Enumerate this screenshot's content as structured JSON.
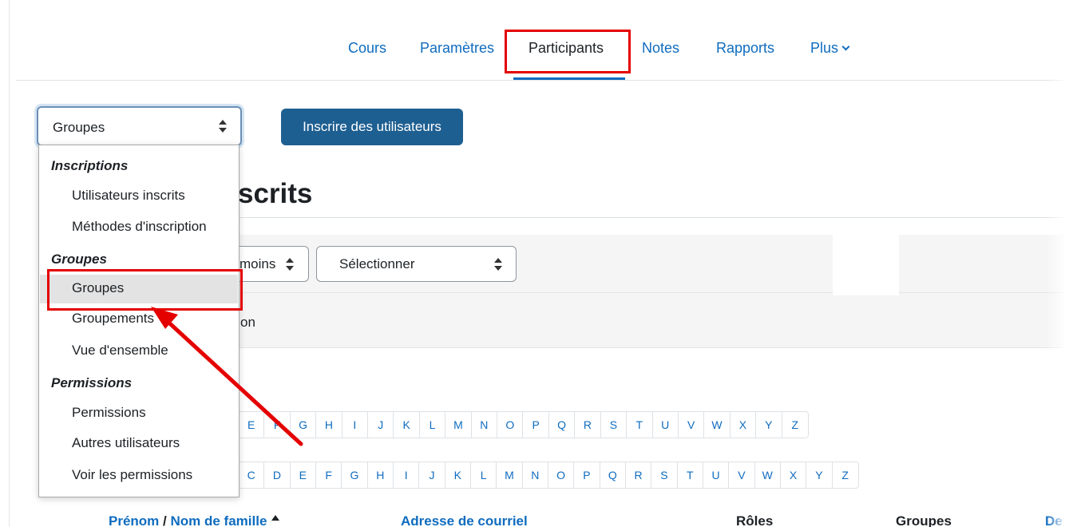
{
  "nav": {
    "items": [
      "Cours",
      "Paramètres",
      "Participants",
      "Notes",
      "Rapports",
      "Plus"
    ],
    "active": "Participants"
  },
  "main_select": {
    "value": "Groupes"
  },
  "enrol_button": {
    "label": "Inscrire des utilisateurs"
  },
  "heading": {
    "text": "scrits"
  },
  "filters": {
    "match_select": "moins",
    "type_select": "Sélectionner",
    "band_text": "on"
  },
  "dropdown": {
    "groups": [
      {
        "label": "Inscriptions",
        "options": [
          "Utilisateurs inscrits",
          "Méthodes d'inscription"
        ]
      },
      {
        "label": "Groupes",
        "options": [
          "Groupes",
          "Groupements",
          "Vue d'ensemble"
        ]
      },
      {
        "label": "Permissions",
        "options": [
          "Permissions",
          "Autres utilisateurs",
          "Voir les permissions"
        ]
      }
    ],
    "selected": "Groupes"
  },
  "initials_firstname": [
    "E",
    "F",
    "G",
    "H",
    "I",
    "J",
    "K",
    "L",
    "M",
    "N",
    "O",
    "P",
    "Q",
    "R",
    "S",
    "T",
    "U",
    "V",
    "W",
    "X",
    "Y",
    "Z"
  ],
  "initials_lastname": [
    "C",
    "D",
    "E",
    "F",
    "G",
    "H",
    "I",
    "J",
    "K",
    "L",
    "M",
    "N",
    "O",
    "P",
    "Q",
    "R",
    "S",
    "T",
    "U",
    "V",
    "W",
    "X",
    "Y",
    "Z"
  ],
  "table": {
    "firstname": "Prénom",
    "separator": "/",
    "lastname": "Nom de famille",
    "email": "Adresse de courriel",
    "roles": "Rôles",
    "groups": "Groupes",
    "last": "De"
  },
  "colors": {
    "accent": "#0f6cbf",
    "button": "#1e5f91",
    "highlight": "#e50000"
  }
}
